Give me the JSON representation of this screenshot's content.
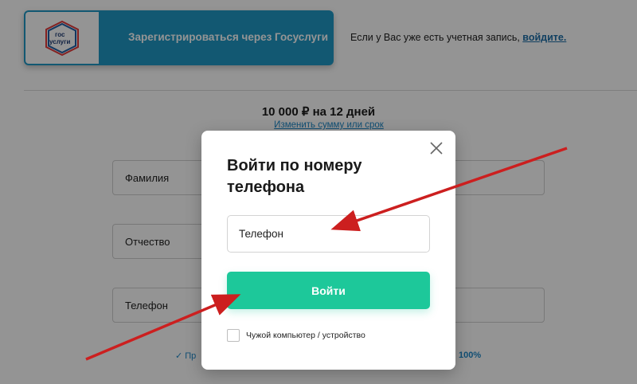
{
  "gosuslugi": {
    "logo_text_top": "гос",
    "logo_text_bottom": "услуги",
    "register_label": "Зарегистрироваться через Госуслуги"
  },
  "account_note": {
    "text": "Если у Вас уже есть учетная запись, ",
    "link": "войдите."
  },
  "loan": {
    "amount": "10 000 ₽ на 12 дней",
    "change_link": "Изменить сумму или срок"
  },
  "background_form": {
    "surname": "Фамилия",
    "patronymic": "Отчество",
    "phone": "Телефон",
    "footnote_left": "✓ Пр",
    "footnote_right": "100%"
  },
  "modal": {
    "title": "Войти по номеру телефона",
    "phone_placeholder": "Телефон",
    "login_button": "Войти",
    "checkbox_label": "Чужой компьютер / устройство"
  },
  "colors": {
    "gosuslugi_blue": "#1f98c4",
    "login_green": "#1dc89a",
    "arrow_red": "#cc1f1f",
    "link_blue": "#1e6fa8"
  },
  "icons": [
    "gosuslugi-logo-icon",
    "close-icon",
    "annotation-arrow-icon"
  ]
}
